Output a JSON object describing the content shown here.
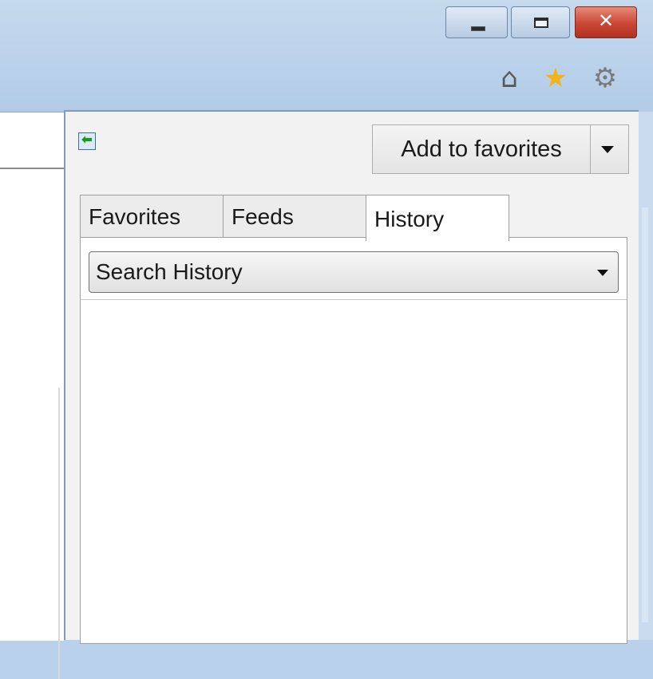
{
  "window": {
    "controls": [
      "minimize",
      "maximize",
      "close"
    ],
    "close_glyph": "✕",
    "accent_close": "#c94634"
  },
  "toolbar": {
    "icons": [
      "home-icon",
      "star-icon",
      "gear-icon"
    ],
    "home_glyph": "⌂",
    "star_glyph": "★",
    "gear_glyph": "⚙"
  },
  "favorites_pane": {
    "pin_glyph": "⬅",
    "add_button_label": "Add to favorites",
    "tabs": [
      {
        "label": "Favorites",
        "selected": false
      },
      {
        "label": "Feeds",
        "selected": false
      },
      {
        "label": "History",
        "selected": true
      }
    ],
    "history_view": {
      "selected": "Search History"
    }
  }
}
